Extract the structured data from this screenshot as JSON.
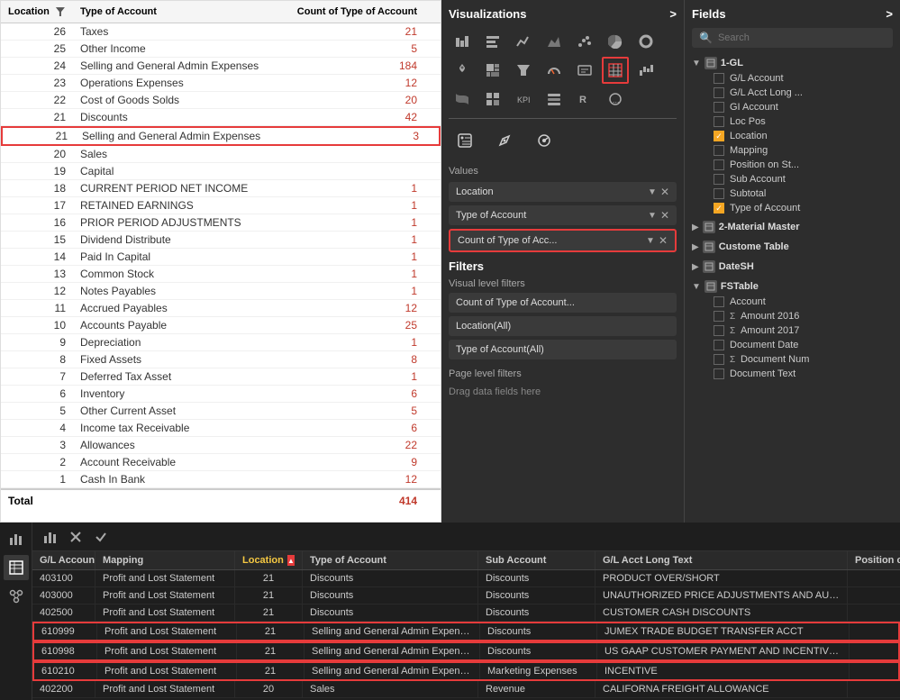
{
  "viz_panel": {
    "title": "Visualizations",
    "arrow": ">",
    "values_label": "Values",
    "chips": [
      {
        "id": "location",
        "label": "Location",
        "bordered": false
      },
      {
        "id": "type",
        "label": "Type of Account",
        "bordered": false
      },
      {
        "id": "count",
        "label": "Count of Type of Acc...",
        "bordered": true
      }
    ],
    "filters": {
      "title": "Filters",
      "visual_label": "Visual level filters",
      "btns": [
        "Count of Type of Account...",
        "Location(All)",
        "Type of Account(All)"
      ],
      "page_label": "Page level filters",
      "drag_text": "Drag data fields here"
    }
  },
  "fields_panel": {
    "title": "Fields",
    "arrow": ">",
    "search_placeholder": "Search",
    "groups": [
      {
        "id": "1gl",
        "label": "1-GL",
        "expanded": true,
        "items": [
          {
            "label": "G/L Account",
            "checked": false,
            "sigma": false
          },
          {
            "label": "G/L Acct Long ...",
            "checked": false,
            "sigma": false
          },
          {
            "label": "GI Account",
            "checked": false,
            "sigma": false
          },
          {
            "label": "Loc Pos",
            "checked": false,
            "sigma": false
          },
          {
            "label": "Location",
            "checked": true,
            "sigma": false
          },
          {
            "label": "Mapping",
            "checked": false,
            "sigma": false
          },
          {
            "label": "Position on St...",
            "checked": false,
            "sigma": false
          },
          {
            "label": "Sub Account",
            "checked": false,
            "sigma": false
          },
          {
            "label": "Subtotal",
            "checked": false,
            "sigma": false
          },
          {
            "label": "Type of Account",
            "checked": true,
            "sigma": false
          }
        ]
      },
      {
        "id": "2material",
        "label": "2-Material Master",
        "expanded": false,
        "items": []
      },
      {
        "id": "custome",
        "label": "Custome Table",
        "expanded": false,
        "items": []
      },
      {
        "id": "datesh",
        "label": "DateSH",
        "expanded": false,
        "items": []
      },
      {
        "id": "fstable",
        "label": "FSTable",
        "expanded": true,
        "items": [
          {
            "label": "Account",
            "checked": false,
            "sigma": false
          },
          {
            "label": "Amount 2016",
            "checked": false,
            "sigma": true
          },
          {
            "label": "Amount 2017",
            "checked": false,
            "sigma": true
          },
          {
            "label": "Document Date",
            "checked": false,
            "sigma": false
          },
          {
            "label": "Document Num",
            "checked": false,
            "sigma": true
          },
          {
            "label": "Document Text",
            "checked": false,
            "sigma": false
          }
        ]
      }
    ]
  },
  "main_table": {
    "headers": [
      "Location",
      "Type of Account",
      "Count of Type of Account"
    ],
    "rows": [
      {
        "loc": "26",
        "type": "Taxes",
        "count": "21",
        "red": true
      },
      {
        "loc": "25",
        "type": "Other Income",
        "count": "5",
        "red": true
      },
      {
        "loc": "24",
        "type": "Selling and General Admin Expenses",
        "count": "184",
        "red": true
      },
      {
        "loc": "23",
        "type": "Operations Expenses",
        "count": "12",
        "red": true
      },
      {
        "loc": "22",
        "type": "Cost of Goods Solds",
        "count": "20",
        "red": true
      },
      {
        "loc": "21",
        "type": "Discounts",
        "count": "42",
        "red": true
      },
      {
        "loc": "21",
        "type": "Selling and General Admin Expenses",
        "count": "3",
        "red": true,
        "highlighted": true
      },
      {
        "loc": "20",
        "type": "Sales",
        "count": "",
        "red": false
      },
      {
        "loc": "19",
        "type": "Capital",
        "count": "",
        "red": false
      },
      {
        "loc": "18",
        "type": "CURRENT PERIOD NET INCOME",
        "count": "1",
        "red": true
      },
      {
        "loc": "17",
        "type": "RETAINED EARNINGS",
        "count": "1",
        "red": true
      },
      {
        "loc": "16",
        "type": "PRIOR PERIOD ADJUSTMENTS",
        "count": "1",
        "red": true
      },
      {
        "loc": "15",
        "type": "Dividend Distribute",
        "count": "1",
        "red": true
      },
      {
        "loc": "14",
        "type": "Paid In Capital",
        "count": "1",
        "red": true
      },
      {
        "loc": "13",
        "type": "Common Stock",
        "count": "1",
        "red": true
      },
      {
        "loc": "12",
        "type": "Notes Payables",
        "count": "1",
        "red": true
      },
      {
        "loc": "11",
        "type": "Accrued Payables",
        "count": "12",
        "red": true
      },
      {
        "loc": "10",
        "type": "Accounts Payable",
        "count": "25",
        "red": true
      },
      {
        "loc": "9",
        "type": "Depreciation",
        "count": "1",
        "red": true
      },
      {
        "loc": "8",
        "type": "Fixed Assets",
        "count": "8",
        "red": true
      },
      {
        "loc": "7",
        "type": "Deferred Tax Asset",
        "count": "1",
        "red": true
      },
      {
        "loc": "6",
        "type": "Inventory",
        "count": "6",
        "red": true
      },
      {
        "loc": "5",
        "type": "Other Current Asset",
        "count": "5",
        "red": true
      },
      {
        "loc": "4",
        "type": "Income tax Receivable",
        "count": "6",
        "red": true
      },
      {
        "loc": "3",
        "type": "Allowances",
        "count": "22",
        "red": true
      },
      {
        "loc": "2",
        "type": "Account Receivable",
        "count": "9",
        "red": true
      },
      {
        "loc": "1",
        "type": "Cash In Bank",
        "count": "12",
        "red": true
      }
    ],
    "total": {
      "label": "Total",
      "value": "414"
    }
  },
  "bottom_table": {
    "headers": [
      "G/L Account",
      "Mapping",
      "Location",
      "Type of Account",
      "Sub Account",
      "G/L Acct Long Text",
      "Position on Stat"
    ],
    "rows": [
      {
        "gl": "403100",
        "mapping": "Profit and Lost Statement",
        "loc": "21",
        "type": "Discounts",
        "sub": "Discounts",
        "long": "PRODUCT OVER/SHORT",
        "pos": "",
        "highlighted": false
      },
      {
        "gl": "403000",
        "mapping": "Profit and Lost Statement",
        "loc": "21",
        "type": "Discounts",
        "sub": "Discounts",
        "long": "UNAUTHORIZED PRICE ADJUSTMENTS AND AUDITS",
        "pos": "",
        "highlighted": false
      },
      {
        "gl": "402500",
        "mapping": "Profit and Lost Statement",
        "loc": "21",
        "type": "Discounts",
        "sub": "Discounts",
        "long": "CUSTOMER CASH DISCOUNTS",
        "pos": "",
        "highlighted": false
      },
      {
        "gl": "610999",
        "mapping": "Profit and Lost Statement",
        "loc": "21",
        "type": "Selling and General Admin Expenses",
        "sub": "Discounts",
        "long": "JUMEX TRADE BUDGET TRANSFER ACCT",
        "pos": "",
        "highlighted": true
      },
      {
        "gl": "610998",
        "mapping": "Profit and Lost Statement",
        "loc": "21",
        "type": "Selling and General Admin Expenses",
        "sub": "Discounts",
        "long": "US GAAP CUSTOMER PAYMENT AND INCENTIVES",
        "pos": "",
        "highlighted": true
      },
      {
        "gl": "610210",
        "mapping": "Profit and Lost Statement",
        "loc": "21",
        "type": "Selling and General Admin Expenses",
        "sub": "Marketing Expenses",
        "long": "INCENTIVE",
        "pos": "",
        "highlighted": true
      },
      {
        "gl": "402200",
        "mapping": "Profit and Lost Statement",
        "loc": "20",
        "type": "Sales",
        "sub": "Revenue",
        "long": "CALIFORNA FREIGHT ALLOWANCE",
        "pos": "",
        "highlighted": false
      }
    ]
  },
  "toolbar": {
    "icons": [
      "chart-bar",
      "x",
      "check"
    ]
  }
}
